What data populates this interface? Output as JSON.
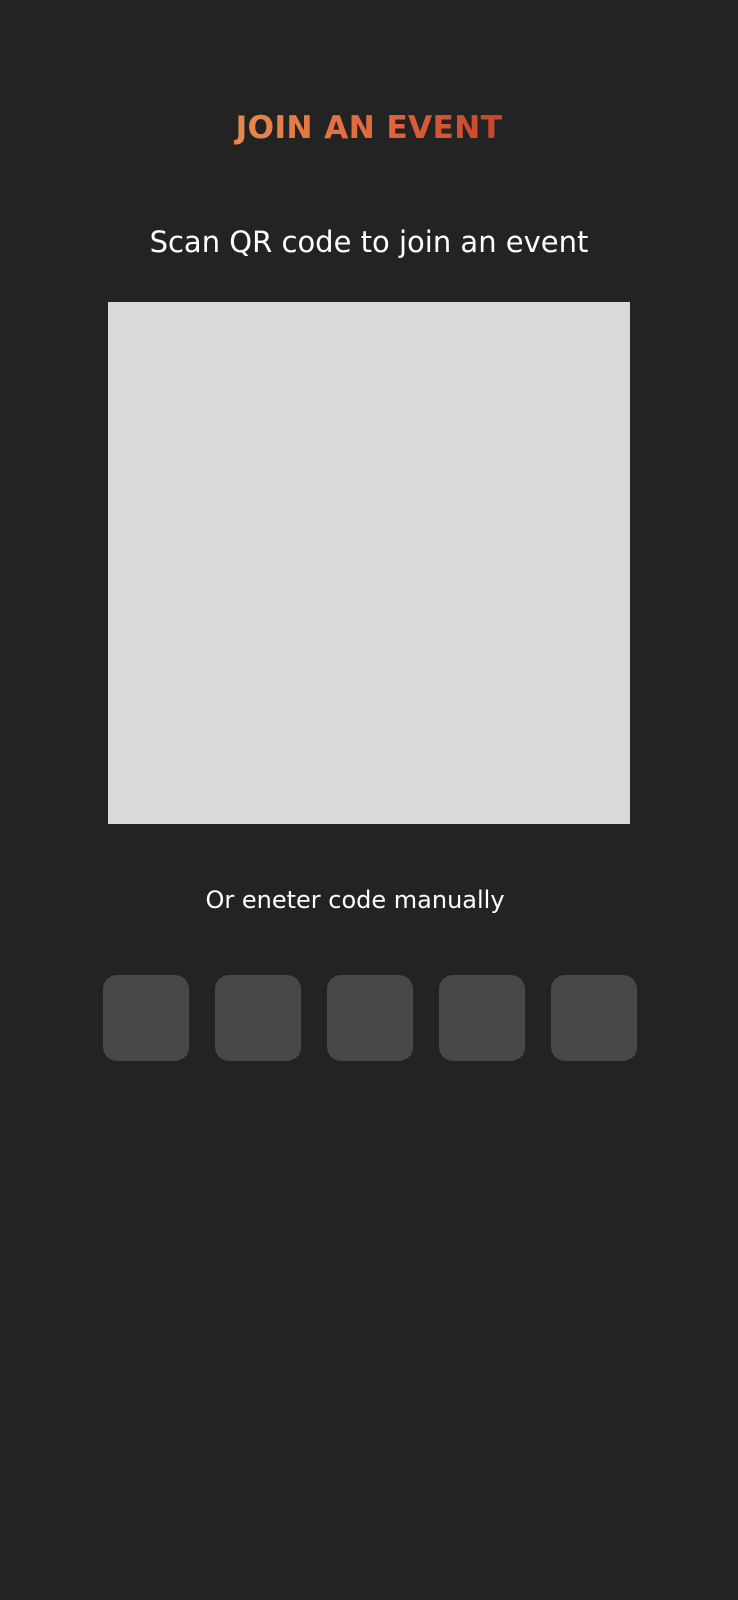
{
  "header": {
    "title": "JOIN AN EVENT"
  },
  "scan": {
    "instruction": "Scan QR code to join an event"
  },
  "manual": {
    "label": "Or eneter code manually",
    "code_digits": [
      "",
      "",
      "",
      "",
      ""
    ]
  },
  "colors": {
    "background": "#232323",
    "title_gradient_start": "#e58a4e",
    "title_gradient_end": "#c9442b",
    "scanner_area": "#d9d9d9",
    "code_box": "#484848",
    "text": "#ffffff"
  }
}
